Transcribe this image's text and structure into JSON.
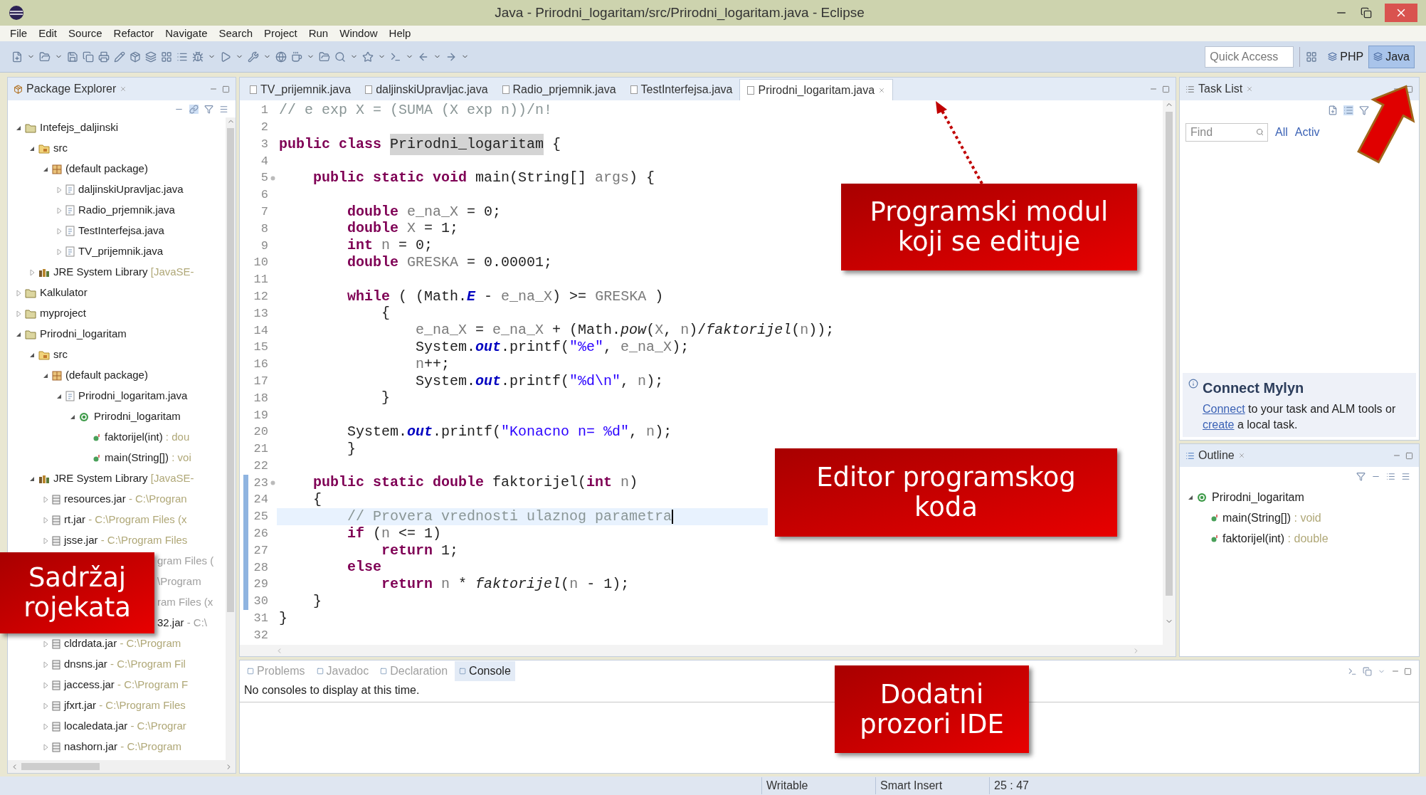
{
  "window": {
    "title": "Java - Prirodni_logaritam/src/Prirodni_logaritam.java - Eclipse"
  },
  "menu": [
    "File",
    "Edit",
    "Source",
    "Refactor",
    "Navigate",
    "Search",
    "Project",
    "Run",
    "Window",
    "Help"
  ],
  "toolbar": {
    "quick_access": {
      "placeholder": "Quick Access"
    },
    "perspectives": [
      {
        "label": "PHP",
        "selected": false
      },
      {
        "label": "Java",
        "selected": true
      }
    ]
  },
  "package_explorer": {
    "title": "Package Explorer",
    "tree": [
      {
        "label": "Intefejs_daljinski",
        "kind": "project",
        "expanded": true,
        "children": [
          {
            "label": "src",
            "kind": "src",
            "expanded": true,
            "children": [
              {
                "label": "(default package)",
                "kind": "package",
                "expanded": true,
                "children": [
                  {
                    "label": "daljinskiUpravljac.java",
                    "kind": "java",
                    "expanded": false
                  },
                  {
                    "label": "Radio_prjemnik.java",
                    "kind": "java",
                    "expanded": false
                  },
                  {
                    "label": "TestInterfejsa.java",
                    "kind": "java",
                    "expanded": false
                  },
                  {
                    "label": "TV_prijemnik.java",
                    "kind": "java",
                    "expanded": false
                  }
                ]
              }
            ]
          },
          {
            "label": "JRE System Library",
            "detail": "[JavaSE-",
            "kind": "library",
            "expanded": false
          }
        ]
      },
      {
        "label": "Kalkulator",
        "kind": "project",
        "expanded": false
      },
      {
        "label": "myproject",
        "kind": "project",
        "expanded": false
      },
      {
        "label": "Prirodni_logaritam",
        "kind": "project",
        "expanded": true,
        "children": [
          {
            "label": "src",
            "kind": "src",
            "expanded": true,
            "children": [
              {
                "label": "(default package)",
                "kind": "package",
                "expanded": true,
                "children": [
                  {
                    "label": "Prirodni_logaritam.java",
                    "kind": "java",
                    "expanded": true,
                    "children": [
                      {
                        "label": "Prirodni_logaritam",
                        "kind": "class",
                        "expanded": true,
                        "children": [
                          {
                            "label": "faktorijel(int)",
                            "detail": ": dou",
                            "kind": "method"
                          },
                          {
                            "label": "main(String[])",
                            "detail": ": voi",
                            "kind": "method"
                          }
                        ]
                      }
                    ]
                  }
                ]
              }
            ]
          },
          {
            "label": "JRE System Library",
            "detail": "[JavaSE-",
            "kind": "library",
            "expanded": true,
            "children": [
              {
                "label": "resources.jar",
                "detail": "- C:\\Progran",
                "kind": "jar",
                "expanded": false
              },
              {
                "label": "rt.jar",
                "detail": "- C:\\Program Files (x",
                "kind": "jar",
                "expanded": false
              },
              {
                "label": "jsse.jar",
                "detail": "- C:\\Program Files",
                "kind": "jar",
                "expanded": false
              },
              {
                "detail": "gram Files (",
                "kind": "covered"
              },
              {
                "detail": "\\Program",
                "kind": "covered"
              },
              {
                "detail": "ram Files (x",
                "kind": "covered"
              },
              {
                "label": "32.jar",
                "detail": "- C:\\",
                "kind": "covered"
              },
              {
                "label": "cldrdata.jar",
                "detail": "- C:\\Program",
                "kind": "jar",
                "expanded": false
              },
              {
                "label": "dnsns.jar",
                "detail": "- C:\\Program Fil",
                "kind": "jar",
                "expanded": false
              },
              {
                "label": "jaccess.jar",
                "detail": "- C:\\Program F",
                "kind": "jar",
                "expanded": false
              },
              {
                "label": "jfxrt.jar",
                "detail": "- C:\\Program Files",
                "kind": "jar",
                "expanded": false
              },
              {
                "label": "localedata.jar",
                "detail": "- C:\\Prograr",
                "kind": "jar",
                "expanded": false
              },
              {
                "label": "nashorn.jar",
                "detail": "- C:\\Program",
                "kind": "jar",
                "expanded": false
              }
            ]
          }
        ]
      }
    ]
  },
  "editor": {
    "tabs": [
      {
        "label": "TV_prijemnik.java",
        "selected": false
      },
      {
        "label": "daljinskiUpravljac.java",
        "selected": false
      },
      {
        "label": "Radio_prjemnik.java",
        "selected": false
      },
      {
        "label": "TestInterfejsa.java",
        "selected": false
      },
      {
        "label": "Prirodni_logaritam.java",
        "selected": true
      }
    ],
    "lines": [
      {
        "n": "1",
        "fold": false,
        "range": false,
        "current": false,
        "tokens": [
          {
            "kind": "comment",
            "text": "// e exp X = (SUMA (X exp n))/n!"
          }
        ]
      },
      {
        "n": "2",
        "fold": false,
        "range": false,
        "current": false
      },
      {
        "n": "3",
        "fold": false,
        "range": false,
        "current": false,
        "tokens": [
          {
            "kind": "kw",
            "text": "public class "
          },
          {
            "kind": "occurrence",
            "text": "Prirodni_logaritam"
          },
          {
            "kind": "plain",
            "text": " {"
          }
        ]
      },
      {
        "n": "4",
        "fold": false,
        "range": false,
        "current": false
      },
      {
        "n": "5",
        "fold": true,
        "range": false,
        "current": false,
        "tokens": [
          {
            "kind": "kw",
            "text": "    public static void "
          },
          {
            "kind": "plain",
            "text": "main(String[] "
          },
          {
            "kind": "var",
            "text": "args"
          },
          {
            "kind": "plain",
            "text": ") {"
          }
        ]
      },
      {
        "n": "6",
        "fold": false,
        "range": false,
        "current": false
      },
      {
        "n": "7",
        "fold": false,
        "range": false,
        "current": false,
        "tokens": [
          {
            "kind": "kw",
            "text": "        double "
          },
          {
            "kind": "var",
            "text": "e_na_X"
          },
          {
            "kind": "plain",
            "text": " = 0;"
          }
        ]
      },
      {
        "n": "8",
        "fold": false,
        "range": false,
        "current": false,
        "tokens": [
          {
            "kind": "kw",
            "text": "        double "
          },
          {
            "kind": "var",
            "text": "X"
          },
          {
            "kind": "plain",
            "text": " = 1;"
          }
        ]
      },
      {
        "n": "9",
        "fold": false,
        "range": false,
        "current": false,
        "tokens": [
          {
            "kind": "kw",
            "text": "        int "
          },
          {
            "kind": "var",
            "text": "n"
          },
          {
            "kind": "plain",
            "text": " = 0;"
          }
        ]
      },
      {
        "n": "10",
        "fold": false,
        "range": false,
        "current": false,
        "tokens": [
          {
            "kind": "kw",
            "text": "        double "
          },
          {
            "kind": "var",
            "text": "GRESKA"
          },
          {
            "kind": "plain",
            "text": " = 0.00001;"
          }
        ]
      },
      {
        "n": "11",
        "fold": false,
        "range": false,
        "current": false
      },
      {
        "n": "12",
        "fold": false,
        "range": false,
        "current": false,
        "tokens": [
          {
            "kind": "kw",
            "text": "        while"
          },
          {
            "kind": "plain",
            "text": " ( (Math."
          },
          {
            "kind": "field",
            "text": "E"
          },
          {
            "kind": "plain",
            "text": " - "
          },
          {
            "kind": "var",
            "text": "e_na_X"
          },
          {
            "kind": "plain",
            "text": ") >= "
          },
          {
            "kind": "var",
            "text": "GRESKA"
          },
          {
            "kind": "plain",
            "text": " )"
          }
        ]
      },
      {
        "n": "13",
        "fold": false,
        "range": false,
        "current": false,
        "tokens": [
          {
            "kind": "plain",
            "text": "            {"
          }
        ]
      },
      {
        "n": "14",
        "fold": false,
        "range": false,
        "current": false,
        "tokens": [
          {
            "kind": "var",
            "text": "                e_na_X"
          },
          {
            "kind": "plain",
            "text": " = "
          },
          {
            "kind": "var",
            "text": "e_na_X"
          },
          {
            "kind": "plain",
            "text": " + (Math."
          },
          {
            "kind": "italic",
            "text": "pow"
          },
          {
            "kind": "plain",
            "text": "("
          },
          {
            "kind": "var",
            "text": "X"
          },
          {
            "kind": "plain",
            "text": ", "
          },
          {
            "kind": "var",
            "text": "n"
          },
          {
            "kind": "plain",
            "text": ")/"
          },
          {
            "kind": "italic",
            "text": "faktorijel"
          },
          {
            "kind": "plain",
            "text": "("
          },
          {
            "kind": "var",
            "text": "n"
          },
          {
            "kind": "plain",
            "text": "));"
          }
        ]
      },
      {
        "n": "15",
        "fold": false,
        "range": false,
        "current": false,
        "tokens": [
          {
            "kind": "plain",
            "text": "                System."
          },
          {
            "kind": "field",
            "text": "out"
          },
          {
            "kind": "plain",
            "text": ".printf("
          },
          {
            "kind": "str",
            "text": "\"%e\""
          },
          {
            "kind": "plain",
            "text": ", "
          },
          {
            "kind": "var",
            "text": "e_na_X"
          },
          {
            "kind": "plain",
            "text": ");"
          }
        ]
      },
      {
        "n": "16",
        "fold": false,
        "range": false,
        "current": false,
        "tokens": [
          {
            "kind": "var",
            "text": "                n"
          },
          {
            "kind": "plain",
            "text": "++;"
          }
        ]
      },
      {
        "n": "17",
        "fold": false,
        "range": false,
        "current": false,
        "tokens": [
          {
            "kind": "plain",
            "text": "                System."
          },
          {
            "kind": "field",
            "text": "out"
          },
          {
            "kind": "plain",
            "text": ".printf("
          },
          {
            "kind": "str",
            "text": "\"%d\\n\""
          },
          {
            "kind": "plain",
            "text": ", "
          },
          {
            "kind": "var",
            "text": "n"
          },
          {
            "kind": "plain",
            "text": ");"
          }
        ]
      },
      {
        "n": "18",
        "fold": false,
        "range": false,
        "current": false,
        "tokens": [
          {
            "kind": "plain",
            "text": "            }"
          }
        ]
      },
      {
        "n": "19",
        "fold": false,
        "range": false,
        "current": false
      },
      {
        "n": "20",
        "fold": false,
        "range": false,
        "current": false,
        "tokens": [
          {
            "kind": "plain",
            "text": "        System."
          },
          {
            "kind": "field",
            "text": "out"
          },
          {
            "kind": "plain",
            "text": ".printf("
          },
          {
            "kind": "str",
            "text": "\"Konacno n= %d\""
          },
          {
            "kind": "plain",
            "text": ", "
          },
          {
            "kind": "var",
            "text": "n"
          },
          {
            "kind": "plain",
            "text": ");"
          }
        ]
      },
      {
        "n": "21",
        "fold": false,
        "range": false,
        "current": false,
        "tokens": [
          {
            "kind": "plain",
            "text": "        }"
          }
        ]
      },
      {
        "n": "22",
        "fold": false,
        "range": false,
        "current": false
      },
      {
        "n": "23",
        "fold": true,
        "range": true,
        "current": false,
        "tokens": [
          {
            "kind": "kw",
            "text": "    public static double "
          },
          {
            "kind": "plain",
            "text": "faktorijel("
          },
          {
            "kind": "kw",
            "text": "int "
          },
          {
            "kind": "var",
            "text": "n"
          },
          {
            "kind": "plain",
            "text": ")"
          }
        ]
      },
      {
        "n": "24",
        "fold": false,
        "range": true,
        "current": false,
        "tokens": [
          {
            "kind": "plain",
            "text": "    {"
          }
        ]
      },
      {
        "n": "25",
        "fold": false,
        "range": true,
        "current": true,
        "tokens": [
          {
            "kind": "comment",
            "text": "        // Provera vrednosti ulaznog parametra"
          }
        ]
      },
      {
        "n": "26",
        "fold": false,
        "range": true,
        "current": false,
        "tokens": [
          {
            "kind": "kw",
            "text": "        if"
          },
          {
            "kind": "plain",
            "text": " ("
          },
          {
            "kind": "var",
            "text": "n"
          },
          {
            "kind": "plain",
            "text": " <= 1)"
          }
        ]
      },
      {
        "n": "27",
        "fold": false,
        "range": true,
        "current": false,
        "tokens": [
          {
            "kind": "kw",
            "text": "            return"
          },
          {
            "kind": "plain",
            "text": " 1;"
          }
        ]
      },
      {
        "n": "28",
        "fold": false,
        "range": true,
        "current": false,
        "tokens": [
          {
            "kind": "kw",
            "text": "        else"
          }
        ]
      },
      {
        "n": "29",
        "fold": false,
        "range": true,
        "current": false,
        "tokens": [
          {
            "kind": "kw",
            "text": "            return "
          },
          {
            "kind": "var",
            "text": "n"
          },
          {
            "kind": "plain",
            "text": " * "
          },
          {
            "kind": "italic",
            "text": "faktorijel"
          },
          {
            "kind": "plain",
            "text": "("
          },
          {
            "kind": "var",
            "text": "n"
          },
          {
            "kind": "plain",
            "text": " - 1);"
          }
        ]
      },
      {
        "n": "30",
        "fold": false,
        "range": true,
        "current": false,
        "tokens": [
          {
            "kind": "plain",
            "text": "    }"
          }
        ]
      },
      {
        "n": "31",
        "fold": false,
        "range": false,
        "current": false,
        "tokens": [
          {
            "kind": "plain",
            "text": "}"
          }
        ]
      },
      {
        "n": "32",
        "fold": false,
        "range": false,
        "current": false
      }
    ]
  },
  "task_list": {
    "title": "Task List",
    "find": {
      "placeholder": "Find"
    },
    "filters": [
      "All",
      "Activ"
    ]
  },
  "mylyn": {
    "title": "Connect Mylyn",
    "parts": [
      {
        "kind": "link",
        "text": "Connect"
      },
      {
        "kind": "text",
        "text": " to your task and ALM tools or "
      },
      {
        "kind": "link",
        "text": "create"
      },
      {
        "kind": "text",
        "text": " a local task."
      }
    ]
  },
  "outline": {
    "title": "Outline",
    "tree": [
      {
        "label": "Prirodni_logaritam",
        "kind": "class",
        "expanded": true,
        "children": [
          {
            "label": "main(String[])",
            "detail": ": void",
            "kind": "method"
          },
          {
            "label": "faktorijel(int)",
            "detail": ": double",
            "kind": "method"
          }
        ]
      }
    ]
  },
  "bottom_panel": {
    "tabs": [
      {
        "label": "Problems",
        "selected": false
      },
      {
        "label": "Javadoc",
        "selected": false
      },
      {
        "label": "Declaration",
        "selected": false
      },
      {
        "label": "Console",
        "selected": true
      }
    ],
    "message": "No consoles to display at this time."
  },
  "status_bar": [
    "Writable",
    "Smart Insert",
    "25 : 47"
  ],
  "callouts": [
    {
      "text": "Programski modul\nkoji se edituje"
    },
    {
      "text": "Editor programskog\nkoda"
    },
    {
      "text": "Sadržaj\nrojekata"
    },
    {
      "text": "Dodatni\nprozori IDE"
    }
  ]
}
